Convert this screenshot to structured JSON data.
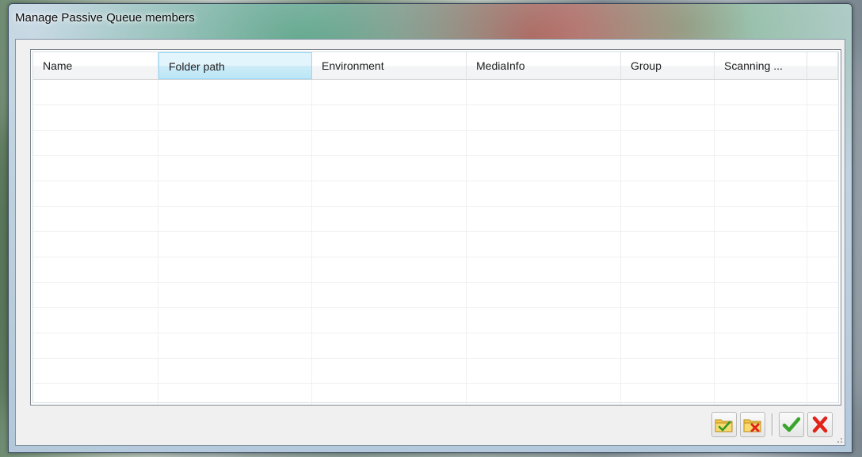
{
  "window": {
    "title": "Manage Passive Queue members"
  },
  "table": {
    "columns": [
      {
        "label": "Name",
        "hot": false
      },
      {
        "label": "Folder path",
        "hot": true
      },
      {
        "label": "Environment",
        "hot": false
      },
      {
        "label": "MediaInfo",
        "hot": false
      },
      {
        "label": "Group",
        "hot": false
      },
      {
        "label": "Scanning ...",
        "hot": false
      }
    ],
    "rows": []
  },
  "toolbar": {
    "buttons": [
      {
        "name": "add-folder-button",
        "icon": "folder-check-icon"
      },
      {
        "name": "remove-folder-button",
        "icon": "folder-remove-icon"
      },
      {
        "name": "ok-button",
        "icon": "green-check-icon"
      },
      {
        "name": "cancel-button",
        "icon": "red-x-icon"
      }
    ]
  },
  "colors": {
    "header_hot": "#bde6f6",
    "ok_green": "#3aa52c",
    "cancel_red": "#e2231a",
    "folder_yellow": "#f3c94b"
  }
}
